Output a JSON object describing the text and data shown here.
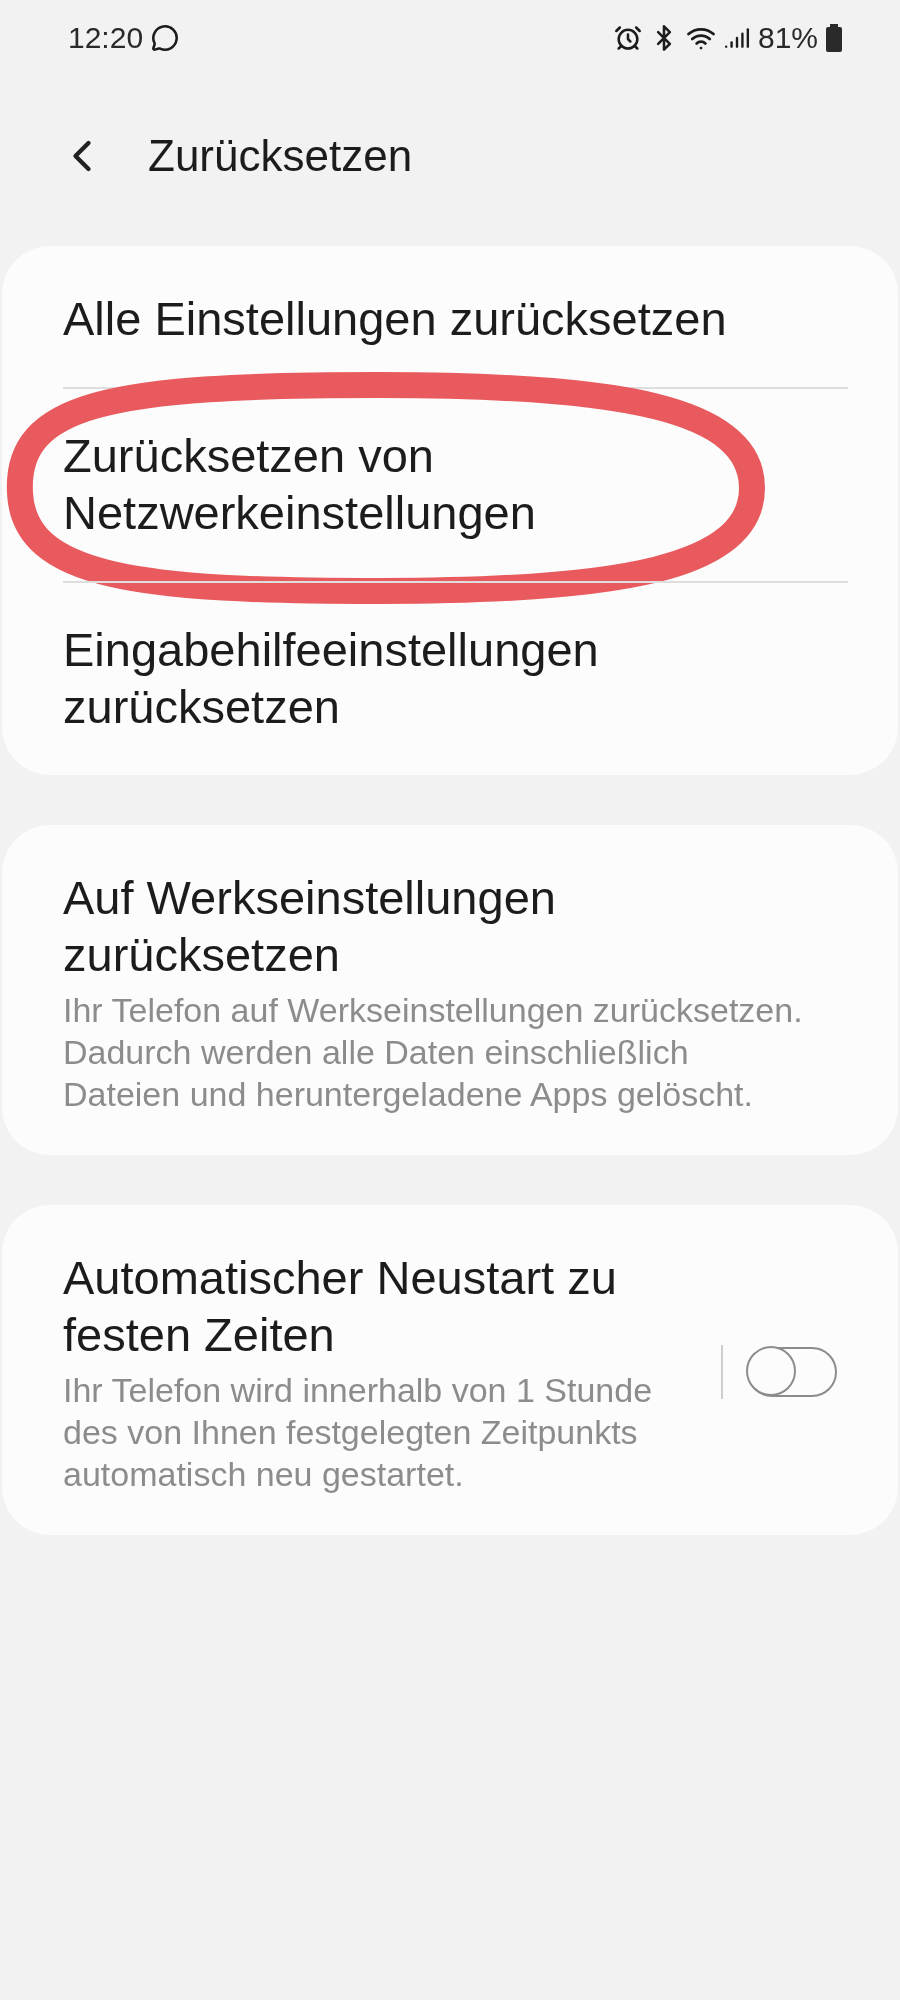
{
  "status_bar": {
    "time": "12:20",
    "battery": "81%"
  },
  "header": {
    "title": "Zurücksetzen"
  },
  "groups": [
    {
      "items": [
        {
          "kind": "plain",
          "title": "Alle Einstellungen zurücksetzen",
          "highlighted": false
        },
        {
          "kind": "plain",
          "title": "Zurücksetzen von Netzwerkeinstellungen",
          "highlighted": true
        },
        {
          "kind": "plain",
          "title": "Eingabehilfeeinstellungen zurücksetzen",
          "highlighted": false
        }
      ]
    },
    {
      "items": [
        {
          "kind": "plain",
          "title": "Auf Werkseinstellungen zurücksetzen",
          "subtitle": "Ihr Telefon auf Werkseinstellungen zurücksetzen. Dadurch werden alle Daten einschließlich Dateien und heruntergeladene Apps gelöscht.",
          "highlighted": false
        }
      ]
    },
    {
      "items": [
        {
          "kind": "toggle",
          "title": "Automatischer Neustart zu festen Zeiten",
          "subtitle": "Ihr Telefon wird innerhalb von 1 Stunde des von Ihnen festgelegten Zeitpunkts automatisch neu gestartet.",
          "on": false,
          "highlighted": false
        }
      ]
    }
  ]
}
